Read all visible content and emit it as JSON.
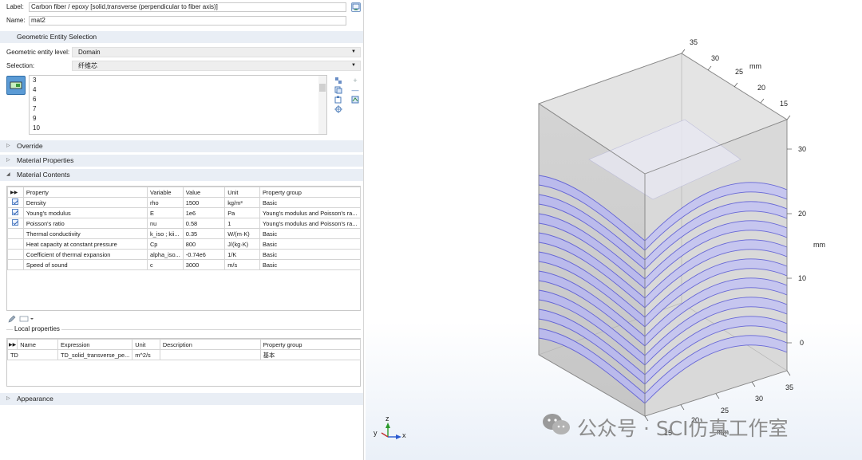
{
  "label_field": {
    "label": "Label:",
    "value": "Carbon fiber / epoxy [solid,transverse (perpendicular to fiber axis)]"
  },
  "name_field": {
    "label": "Name:",
    "value": "mat2"
  },
  "sections": {
    "geometric": "Geometric Entity Selection",
    "override": "Override",
    "material_properties": "Material Properties",
    "material_contents": "Material Contents",
    "appearance": "Appearance"
  },
  "geometric": {
    "level_label": "Geometric entity level:",
    "level_value": "Domain",
    "selection_label": "Selection:",
    "selection_value": "纤维芯",
    "domains": [
      "3",
      "4",
      "6",
      "7",
      "9",
      "10"
    ]
  },
  "contents_table": {
    "headers": [
      "Property",
      "Variable",
      "Value",
      "Unit",
      "Property group"
    ],
    "rows": [
      {
        "checked": true,
        "property": "Density",
        "variable": "rho",
        "value": "1500",
        "unit": "kg/m³",
        "group": "Basic"
      },
      {
        "checked": true,
        "property": "Young's modulus",
        "variable": "E",
        "value": "1e6",
        "unit": "Pa",
        "group": "Young's modulus and Poisson's ra..."
      },
      {
        "checked": true,
        "property": "Poisson's ratio",
        "variable": "nu",
        "value": "0.58",
        "unit": "1",
        "group": "Young's modulus and Poisson's ra..."
      },
      {
        "checked": false,
        "property": "Thermal conductivity",
        "variable": "k_iso ; kii...",
        "value": "0.35",
        "unit": "W/(m·K)",
        "group": "Basic"
      },
      {
        "checked": false,
        "property": "Heat capacity at constant pressure",
        "variable": "Cp",
        "value": "800",
        "unit": "J/(kg·K)",
        "group": "Basic"
      },
      {
        "checked": false,
        "property": "Coefficient of thermal expansion",
        "variable": "alpha_iso...",
        "value": "-0.74e6",
        "unit": "1/K",
        "group": "Basic"
      },
      {
        "checked": false,
        "property": "Speed of sound",
        "variable": "c",
        "value": "3000",
        "unit": "m/s",
        "group": "Basic"
      }
    ]
  },
  "local_properties": {
    "title": "Local properties",
    "headers": [
      "Name",
      "Expression",
      "Unit",
      "Description",
      "Property group"
    ],
    "rows": [
      {
        "name": "TD",
        "expression": "TD_solid_transverse_pe...",
        "unit": "m^2/s",
        "description": "",
        "group": "基本"
      }
    ]
  },
  "view": {
    "axis_unit": "mm",
    "top_ticks": [
      "35",
      "30",
      "25",
      "20",
      "15"
    ],
    "right_ticks": [
      "30",
      "20",
      "10",
      "0"
    ],
    "bottom_ticks": [
      "35",
      "30",
      "25",
      "20",
      "15"
    ],
    "triad": {
      "x": "x",
      "y": "y",
      "z": "z"
    },
    "watermark": "公众号 · SCI仿真工作室",
    "fiber_color": "#5b5bd6"
  }
}
